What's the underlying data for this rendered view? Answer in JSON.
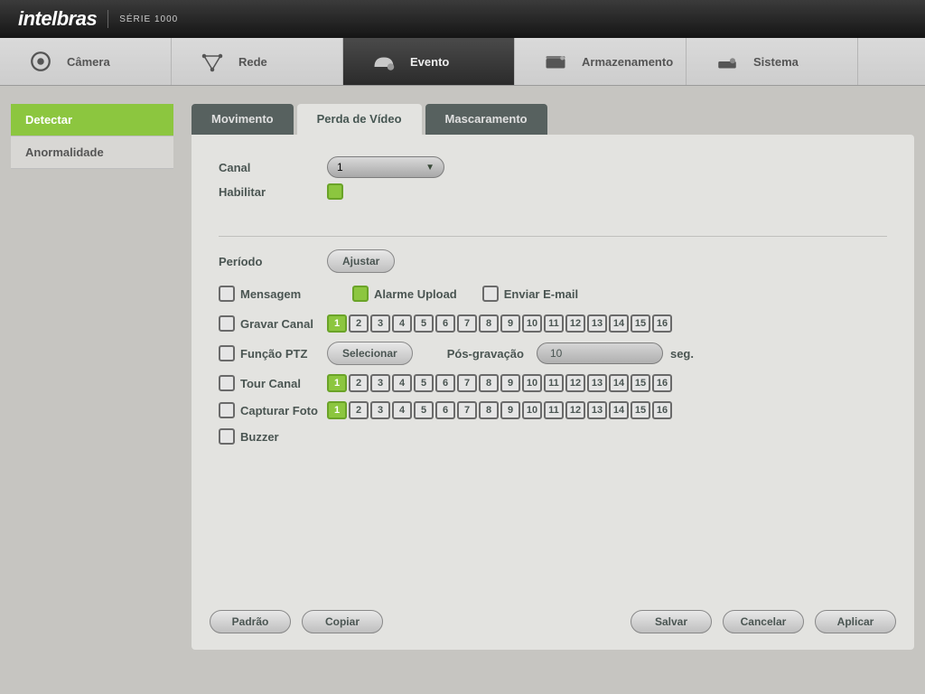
{
  "brand": "intelbras",
  "series": "SÉRIE 1000",
  "nav": {
    "camera": "Câmera",
    "network": "Rede",
    "event": "Evento",
    "storage": "Armazenamento",
    "system": "Sistema"
  },
  "sidebar": {
    "detect": "Detectar",
    "abnormality": "Anormalidade"
  },
  "tabs": {
    "motion": "Movimento",
    "videoloss": "Perda de Vídeo",
    "masking": "Mascaramento"
  },
  "form": {
    "channel_label": "Canal",
    "channel_value": "1",
    "enable_label": "Habilitar",
    "period_label": "Período",
    "adjust_btn": "Ajustar",
    "message_label": "Mensagem",
    "alarm_upload_label": "Alarme Upload",
    "send_email_label": "Enviar E-mail",
    "record_channel_label": "Gravar Canal",
    "ptz_label": "Função PTZ",
    "select_btn": "Selecionar",
    "post_record_label": "Pós-gravação",
    "post_record_value": "10",
    "post_record_unit": "seg.",
    "tour_channel_label": "Tour Canal",
    "snapshot_label": "Capturar Foto",
    "buzzer_label": "Buzzer",
    "channels": [
      "1",
      "2",
      "3",
      "4",
      "5",
      "6",
      "7",
      "8",
      "9",
      "10",
      "11",
      "12",
      "13",
      "14",
      "15",
      "16"
    ],
    "record_selected": [
      0
    ],
    "tour_selected": [
      0
    ],
    "snapshot_selected": [
      0
    ],
    "enable_checked": true,
    "message_checked": false,
    "alarm_upload_checked": true,
    "send_email_checked": false,
    "record_checked": false,
    "ptz_checked": false,
    "tour_checked": false,
    "snapshot_checked": false,
    "buzzer_checked": false
  },
  "footer": {
    "default": "Padrão",
    "copy": "Copiar",
    "save": "Salvar",
    "cancel": "Cancelar",
    "apply": "Aplicar"
  }
}
